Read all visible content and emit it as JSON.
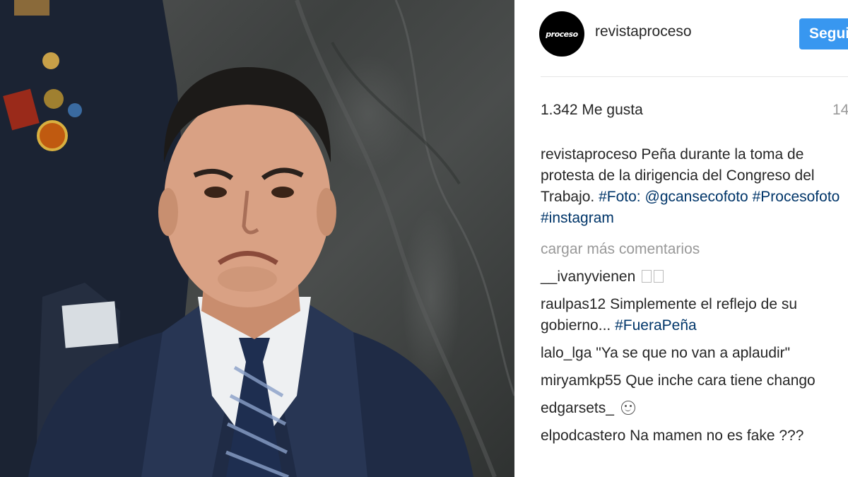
{
  "post": {
    "photo_alt": "photo",
    "account": {
      "avatar_text": "proceso",
      "username": "revistaproceso",
      "follow_label": "Seguir"
    },
    "likes": "1.342 Me gusta",
    "time": "14",
    "caption": {
      "user": "revistaproceso",
      "text": "Peña durante la toma de protesta de la dirigencia del Congreso del Trabajo.",
      "hashtag_foto": "#Foto:",
      "mention": "@gcansecofoto",
      "hashtag_procesofoto": "#Procesofoto",
      "hashtag_instagram": "#instagram"
    },
    "load_more": "cargar más comentarios",
    "comments": [
      {
        "user": "__ivanyvienen",
        "text": ""
      },
      {
        "user": "raulpas12",
        "text": "Simplemente el reflejo de su gobierno...",
        "tag": "#FueraPeña"
      },
      {
        "user": "lalo_lga",
        "text": "\"Ya se que no van a aplaudir\""
      },
      {
        "user": "miryamkp55",
        "text": "Que inche cara tiene chango"
      },
      {
        "user": "edgarsets_",
        "text": ""
      },
      {
        "user": "elpodcastero",
        "text": "Na mamen no es fake ???"
      }
    ]
  },
  "colors": {
    "follow_button": "#3897f0",
    "link": "#003569",
    "muted": "#999999",
    "text": "#262626"
  }
}
